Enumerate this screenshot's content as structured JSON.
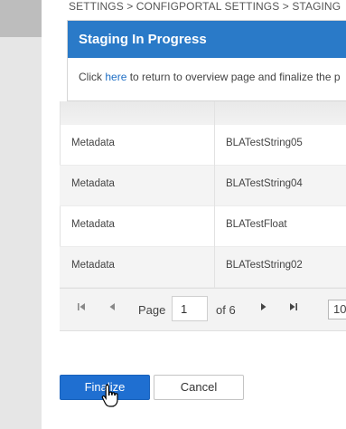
{
  "breadcrumb": "SETTINGS > CONFIGPORTAL SETTINGS > STAGING",
  "panel": {
    "title": "Staging In Progress",
    "message_prefix": "Click ",
    "link_text": "here",
    "message_suffix": " to return to overview page and finalize the p"
  },
  "table": {
    "rows": [
      {
        "type": "Metadata",
        "name": "BLATestString05"
      },
      {
        "type": "Metadata",
        "name": "BLATestString04"
      },
      {
        "type": "Metadata",
        "name": "BLATestFloat"
      },
      {
        "type": "Metadata",
        "name": "BLATestString02"
      }
    ]
  },
  "pager": {
    "page_label": "Page",
    "current_page": "1",
    "of_label": "of 6",
    "page_size": "10"
  },
  "buttons": {
    "finalize": "Finalize",
    "cancel": "Cancel"
  },
  "icons": {
    "first": "first-page-icon",
    "prev": "prev-page-icon",
    "next": "next-page-icon",
    "last": "last-page-icon",
    "cursor": "hand-cursor-icon"
  },
  "colors": {
    "header": "#2a7ac8",
    "primary_button": "#1f6fd1",
    "link": "#1f6fc5"
  }
}
